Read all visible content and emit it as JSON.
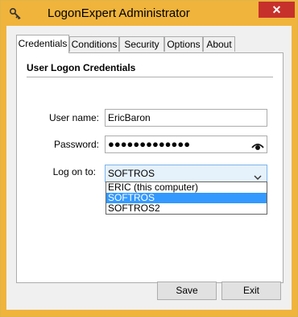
{
  "window": {
    "title": "LogonExpert Administrator",
    "close_glyph": "✕",
    "accent_color": "#f0b43c"
  },
  "tabs": [
    {
      "label": "Credentials",
      "active": true
    },
    {
      "label": "Conditions",
      "active": false
    },
    {
      "label": "Security",
      "active": false
    },
    {
      "label": "Options",
      "active": false
    },
    {
      "label": "About",
      "active": false
    }
  ],
  "credentials": {
    "section_title": "User Logon Credentials",
    "username_label": "User name:",
    "username_value": "EricBaron",
    "password_label": "Password:",
    "password_value": "●●●●●●●●●●●●●",
    "logon_label": "Log on to:",
    "logon_value": "SOFTROS",
    "logon_options": [
      "ERIC (this computer)",
      "SOFTROS",
      "SOFTROS2"
    ],
    "logon_selected_option": "SOFTROS"
  },
  "buttons": {
    "save_label": "Save",
    "exit_label": "Exit"
  }
}
